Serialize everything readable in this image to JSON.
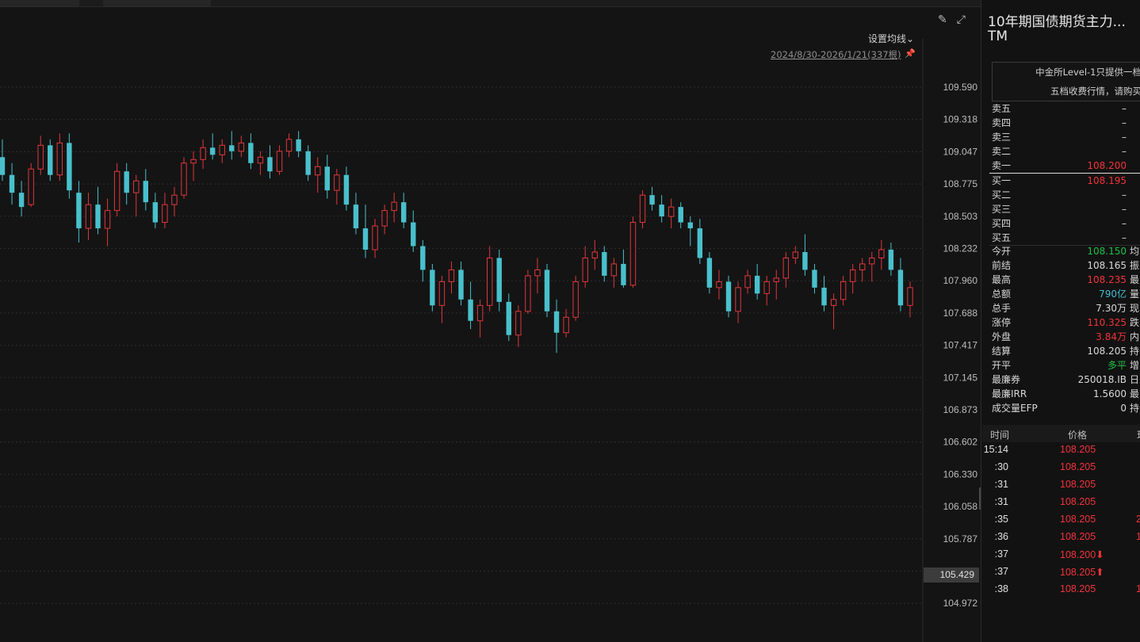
{
  "header": {
    "draw_icon": "✎",
    "fullscreen_icon": "⤢",
    "ma_setting_label": "设置均线⌄",
    "range_label": "2024/8/30-2026/1/21(337根)",
    "pin_icon": "📌"
  },
  "price_axis": [
    "109.590",
    "109.318",
    "109.047",
    "108.775",
    "108.503",
    "108.232",
    "107.960",
    "107.688",
    "107.417",
    "107.145",
    "106.873",
    "106.602",
    "106.330",
    "106.058",
    "105.787",
    "105.429",
    "104.972"
  ],
  "current_price": "105.429",
  "colors": {
    "up": "#e0373c",
    "down": "#49c0cc",
    "bg": "#141414",
    "grid": "#2e2e2e"
  },
  "chart_data": {
    "type": "candlestick",
    "x_range": [
      "2024/8/30",
      "2026/1/21"
    ],
    "bar_count": 337,
    "ylim": [
      104.972,
      109.862
    ],
    "ohlc": [
      [
        109.0,
        109.15,
        108.8,
        108.85
      ],
      [
        108.85,
        108.95,
        108.6,
        108.7
      ],
      [
        108.7,
        108.8,
        108.5,
        108.58
      ],
      [
        108.6,
        108.95,
        108.58,
        108.9
      ],
      [
        108.9,
        109.18,
        108.85,
        109.1
      ],
      [
        109.1,
        109.15,
        108.8,
        108.85
      ],
      [
        108.85,
        109.2,
        108.8,
        109.12
      ],
      [
        109.12,
        109.2,
        108.65,
        108.72
      ],
      [
        108.7,
        108.8,
        108.28,
        108.4
      ],
      [
        108.4,
        108.7,
        108.3,
        108.6
      ],
      [
        108.6,
        108.75,
        108.35,
        108.4
      ],
      [
        108.4,
        108.65,
        108.25,
        108.55
      ],
      [
        108.55,
        108.95,
        108.5,
        108.88
      ],
      [
        108.88,
        108.95,
        108.6,
        108.7
      ],
      [
        108.7,
        108.85,
        108.5,
        108.8
      ],
      [
        108.8,
        108.9,
        108.55,
        108.62
      ],
      [
        108.62,
        108.7,
        108.4,
        108.45
      ],
      [
        108.45,
        108.7,
        108.4,
        108.6
      ],
      [
        108.6,
        108.75,
        108.5,
        108.68
      ],
      [
        108.68,
        109.0,
        108.65,
        108.95
      ],
      [
        108.95,
        109.05,
        108.8,
        108.98
      ],
      [
        108.98,
        109.15,
        108.9,
        109.08
      ],
      [
        109.08,
        109.2,
        108.98,
        109.02
      ],
      [
        109.02,
        109.15,
        108.95,
        109.1
      ],
      [
        109.1,
        109.22,
        108.98,
        109.05
      ],
      [
        109.05,
        109.18,
        109.0,
        109.12
      ],
      [
        109.12,
        109.2,
        108.9,
        108.95
      ],
      [
        108.95,
        109.05,
        108.85,
        109.0
      ],
      [
        109.0,
        109.1,
        108.82,
        108.88
      ],
      [
        108.88,
        109.1,
        108.85,
        109.05
      ],
      [
        109.05,
        109.2,
        109.0,
        109.15
      ],
      [
        109.15,
        109.22,
        109.0,
        109.05
      ],
      [
        109.05,
        109.1,
        108.8,
        108.85
      ],
      [
        108.85,
        109.0,
        108.7,
        108.92
      ],
      [
        108.92,
        109.02,
        108.65,
        108.72
      ],
      [
        108.72,
        108.9,
        108.6,
        108.85
      ],
      [
        108.85,
        108.92,
        108.55,
        108.6
      ],
      [
        108.6,
        108.7,
        108.35,
        108.4
      ],
      [
        108.4,
        108.6,
        108.15,
        108.22
      ],
      [
        108.22,
        108.48,
        108.15,
        108.42
      ],
      [
        108.42,
        108.6,
        108.35,
        108.55
      ],
      [
        108.55,
        108.7,
        108.45,
        108.62
      ],
      [
        108.62,
        108.7,
        108.4,
        108.45
      ],
      [
        108.45,
        108.55,
        108.2,
        108.25
      ],
      [
        108.25,
        108.3,
        107.95,
        108.05
      ],
      [
        108.05,
        108.1,
        107.7,
        107.75
      ],
      [
        107.75,
        108.0,
        107.6,
        107.95
      ],
      [
        107.95,
        108.12,
        107.85,
        108.05
      ],
      [
        108.05,
        108.12,
        107.75,
        107.8
      ],
      [
        107.8,
        107.95,
        107.55,
        107.62
      ],
      [
        107.62,
        107.8,
        107.48,
        107.75
      ],
      [
        107.75,
        108.25,
        107.7,
        108.15
      ],
      [
        108.15,
        108.22,
        107.7,
        107.78
      ],
      [
        107.78,
        107.85,
        107.45,
        107.5
      ],
      [
        107.5,
        107.75,
        107.4,
        107.7
      ],
      [
        107.7,
        108.05,
        107.68,
        108.0
      ],
      [
        108.0,
        108.15,
        107.85,
        108.05
      ],
      [
        108.05,
        108.1,
        107.65,
        107.7
      ],
      [
        107.7,
        107.8,
        107.35,
        107.52
      ],
      [
        107.52,
        107.72,
        107.48,
        107.65
      ],
      [
        107.65,
        108.0,
        107.62,
        107.95
      ],
      [
        107.95,
        108.25,
        107.9,
        108.15
      ],
      [
        108.15,
        108.3,
        108.05,
        108.2
      ],
      [
        108.2,
        108.25,
        107.95,
        108.0
      ],
      [
        108.0,
        108.15,
        107.9,
        108.1
      ],
      [
        108.1,
        108.22,
        107.9,
        107.92
      ],
      [
        107.92,
        108.5,
        107.9,
        108.45
      ],
      [
        108.45,
        108.72,
        108.4,
        108.68
      ],
      [
        108.68,
        108.75,
        108.55,
        108.6
      ],
      [
        108.6,
        108.68,
        108.45,
        108.5
      ],
      [
        108.5,
        108.65,
        108.4,
        108.58
      ],
      [
        108.58,
        108.62,
        108.4,
        108.45
      ],
      [
        108.45,
        108.5,
        108.25,
        108.4
      ],
      [
        108.4,
        108.48,
        108.1,
        108.15
      ],
      [
        108.15,
        108.2,
        107.85,
        107.9
      ],
      [
        107.9,
        108.05,
        107.8,
        107.95
      ],
      [
        107.95,
        108.0,
        107.65,
        107.7
      ],
      [
        107.7,
        107.95,
        107.6,
        107.9
      ],
      [
        107.9,
        108.05,
        107.85,
        108.0
      ],
      [
        108.0,
        108.1,
        107.8,
        107.85
      ],
      [
        107.85,
        108.0,
        107.75,
        107.95
      ],
      [
        107.95,
        108.05,
        107.8,
        107.98
      ],
      [
        107.98,
        108.2,
        107.9,
        108.15
      ],
      [
        108.15,
        108.25,
        108.1,
        108.2
      ],
      [
        108.2,
        108.35,
        108.0,
        108.05
      ],
      [
        108.05,
        108.1,
        107.85,
        107.9
      ],
      [
        107.9,
        108.0,
        107.7,
        107.75
      ],
      [
        107.75,
        107.85,
        107.55,
        107.8
      ],
      [
        107.8,
        108.0,
        107.75,
        107.95
      ],
      [
        107.95,
        108.1,
        107.85,
        108.05
      ],
      [
        108.05,
        108.15,
        107.95,
        108.1
      ],
      [
        108.1,
        108.2,
        107.95,
        108.15
      ],
      [
        108.15,
        108.3,
        108.05,
        108.22
      ],
      [
        108.22,
        108.28,
        108.0,
        108.05
      ],
      [
        108.05,
        108.15,
        107.7,
        107.75
      ],
      [
        107.75,
        107.95,
        107.65,
        107.9
      ]
    ]
  },
  "sidebar": {
    "title": "10年期国债期货主力...",
    "code": "TM",
    "notice": [
      "中金所Level-1只提供一档",
      "五档收费行情，请购买"
    ],
    "asks": [
      {
        "label": "卖五",
        "value": "–",
        "cls": "white"
      },
      {
        "label": "卖四",
        "value": "–",
        "cls": "white"
      },
      {
        "label": "卖三",
        "value": "–",
        "cls": "white"
      },
      {
        "label": "卖二",
        "value": "–",
        "cls": "white"
      },
      {
        "label": "卖一",
        "value": "108.200",
        "cls": "red"
      }
    ],
    "bids": [
      {
        "label": "买一",
        "value": "108.195",
        "cls": "red"
      },
      {
        "label": "买二",
        "value": "–",
        "cls": "white"
      },
      {
        "label": "买三",
        "value": "–",
        "cls": "white"
      },
      {
        "label": "买四",
        "value": "–",
        "cls": "white"
      },
      {
        "label": "买五",
        "value": "–",
        "cls": "white"
      }
    ],
    "stats": [
      {
        "label": "今开",
        "value": "108.150",
        "cls": "green",
        "extra": "均"
      },
      {
        "label": "前结",
        "value": "108.165",
        "cls": "white",
        "extra": "振"
      },
      {
        "label": "最高",
        "value": "108.235",
        "cls": "red",
        "extra": "最"
      },
      {
        "label": "总额",
        "value": "790亿",
        "cls": "cyan",
        "extra": "量"
      },
      {
        "label": "总手",
        "value": "7.30万",
        "cls": "white",
        "extra": "现"
      },
      {
        "label": "涨停",
        "value": "110.325",
        "cls": "red",
        "extra": "跌"
      },
      {
        "label": "外盘",
        "value": "3.84万",
        "cls": "red",
        "extra": "内"
      },
      {
        "label": "结算",
        "value": "108.205",
        "cls": "white",
        "extra": "持"
      },
      {
        "label": "开平",
        "value": "多平",
        "cls": "green",
        "extra": "增"
      },
      {
        "label": "最廉券",
        "value": "250018.IB",
        "cls": "white",
        "extra": "日",
        "lcls": "yel"
      },
      {
        "label": "最廉IRR",
        "value": "1.5600",
        "cls": "white",
        "extra": "最",
        "lcls": "yel"
      },
      {
        "label": "成交量EFP",
        "value": "0",
        "cls": "white",
        "extra": "持"
      }
    ],
    "ticks_header": {
      "time": "时间",
      "price": "价格",
      "extra": "现"
    },
    "ticks": [
      {
        "time": "15:14",
        "price": "108.205",
        "extra": ""
      },
      {
        "time": ":30",
        "price": "108.205",
        "extra": ""
      },
      {
        "time": ":31",
        "price": "108.205",
        "extra": ""
      },
      {
        "time": ":31",
        "price": "108.205",
        "extra": ""
      },
      {
        "time": ":35",
        "price": "108.205",
        "extra": "2"
      },
      {
        "time": ":36",
        "price": "108.205",
        "extra": "1"
      },
      {
        "time": ":37",
        "price": "108.200⬇",
        "extra": ""
      },
      {
        "time": ":37",
        "price": "108.205⬆",
        "extra": ""
      },
      {
        "time": ":38",
        "price": "108.205",
        "extra": "1"
      }
    ]
  }
}
